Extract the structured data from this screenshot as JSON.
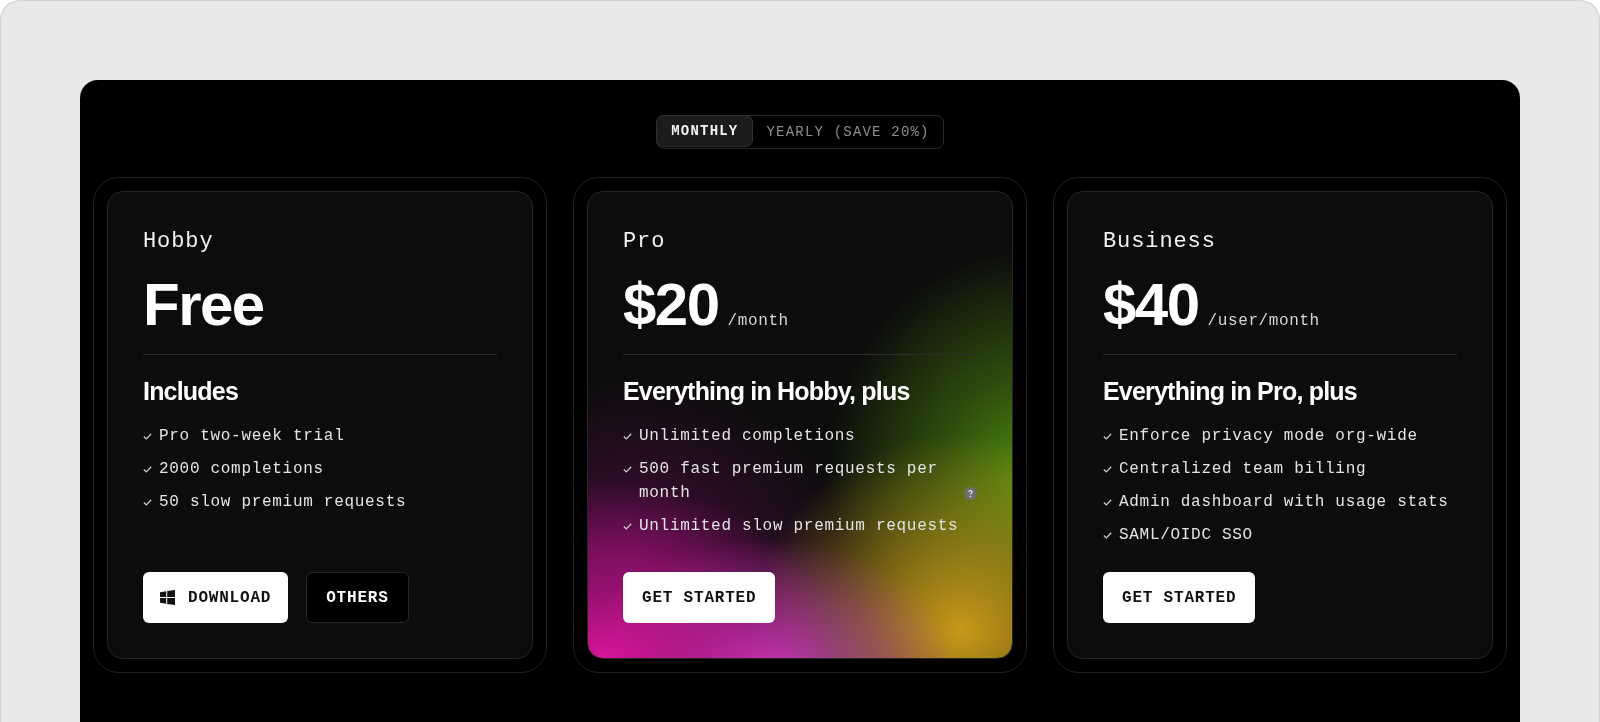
{
  "billing": {
    "options": [
      {
        "label": "MONTHLY",
        "selected": true
      },
      {
        "label": "YEARLY (SAVE 20%)",
        "selected": false
      }
    ]
  },
  "plans": [
    {
      "name": "Hobby",
      "price": "Free",
      "featured": false,
      "heading": "Includes",
      "features": [
        {
          "text": "Pro two-week trial",
          "help": false
        },
        {
          "text": "2000 completions",
          "help": false
        },
        {
          "text": "50 slow premium requests",
          "help": false
        }
      ],
      "buttons": [
        {
          "kind": "download",
          "label": "DOWNLOAD"
        },
        {
          "kind": "others",
          "label": "OTHERS"
        }
      ]
    },
    {
      "name": "Pro",
      "price": "$20",
      "period": "/month",
      "featured": true,
      "heading": "Everything in Hobby, plus",
      "features": [
        {
          "text": "Unlimited completions",
          "help": false
        },
        {
          "text": "500 fast premium requests per month",
          "help": true
        },
        {
          "text": "Unlimited slow premium requests",
          "help": false
        }
      ],
      "buttons": [
        {
          "kind": "start",
          "label": "GET STARTED"
        }
      ]
    },
    {
      "name": "Business",
      "price": "$40",
      "period": "/user/month",
      "featured": false,
      "heading": "Everything in Pro, plus",
      "features": [
        {
          "text": "Enforce privacy mode org-wide",
          "help": false
        },
        {
          "text": "Centralized team billing",
          "help": false
        },
        {
          "text": "Admin dashboard with usage stats",
          "help": false
        },
        {
          "text": "SAML/OIDC SSO",
          "help": false
        }
      ],
      "buttons": [
        {
          "kind": "start",
          "label": "GET STARTED"
        }
      ]
    }
  ]
}
